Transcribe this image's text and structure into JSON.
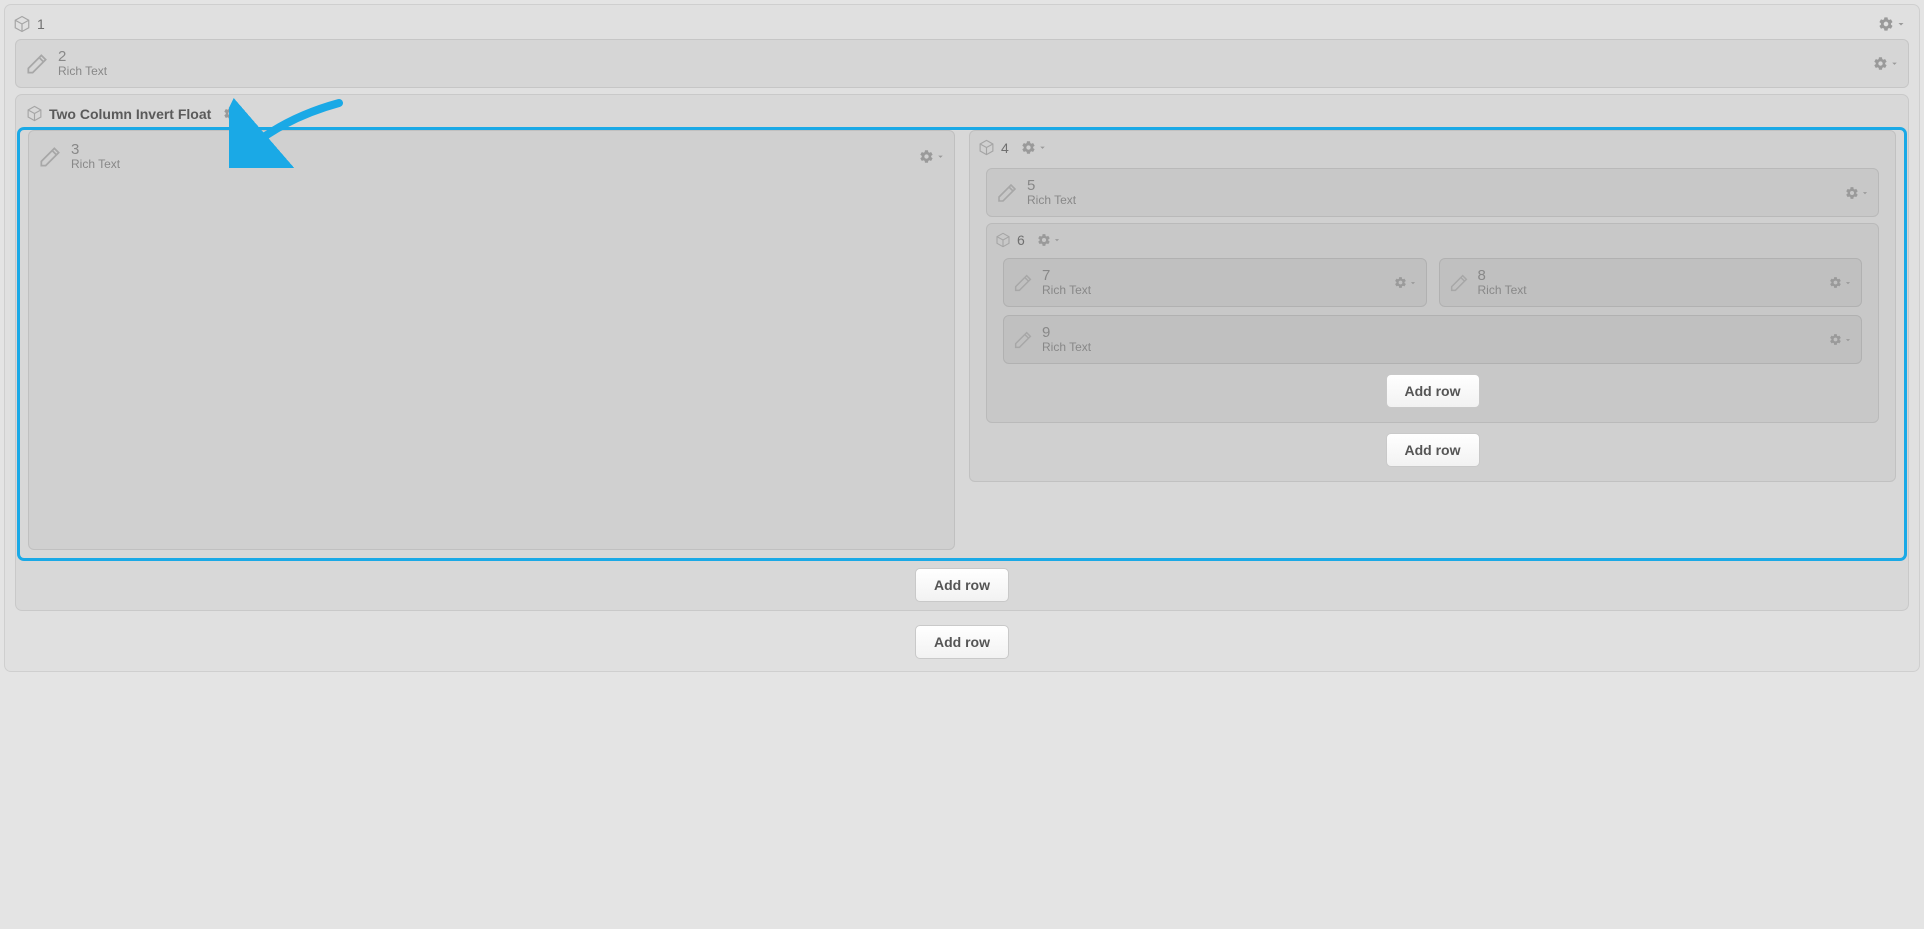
{
  "root": {
    "title": "1"
  },
  "block2": {
    "num": "2",
    "type": "Rich Text"
  },
  "section": {
    "title": "Two Column Invert Float"
  },
  "block3": {
    "num": "3",
    "type": "Rich Text"
  },
  "panel4": {
    "title": "4"
  },
  "block5": {
    "num": "5",
    "type": "Rich Text"
  },
  "panel6": {
    "title": "6"
  },
  "block7": {
    "num": "7",
    "type": "Rich Text"
  },
  "block8": {
    "num": "8",
    "type": "Rich Text"
  },
  "block9": {
    "num": "9",
    "type": "Rich Text"
  },
  "buttons": {
    "add_row": "Add row"
  },
  "colors": {
    "highlight": "#1aa9e6",
    "arrow": "#1aa9e6"
  }
}
